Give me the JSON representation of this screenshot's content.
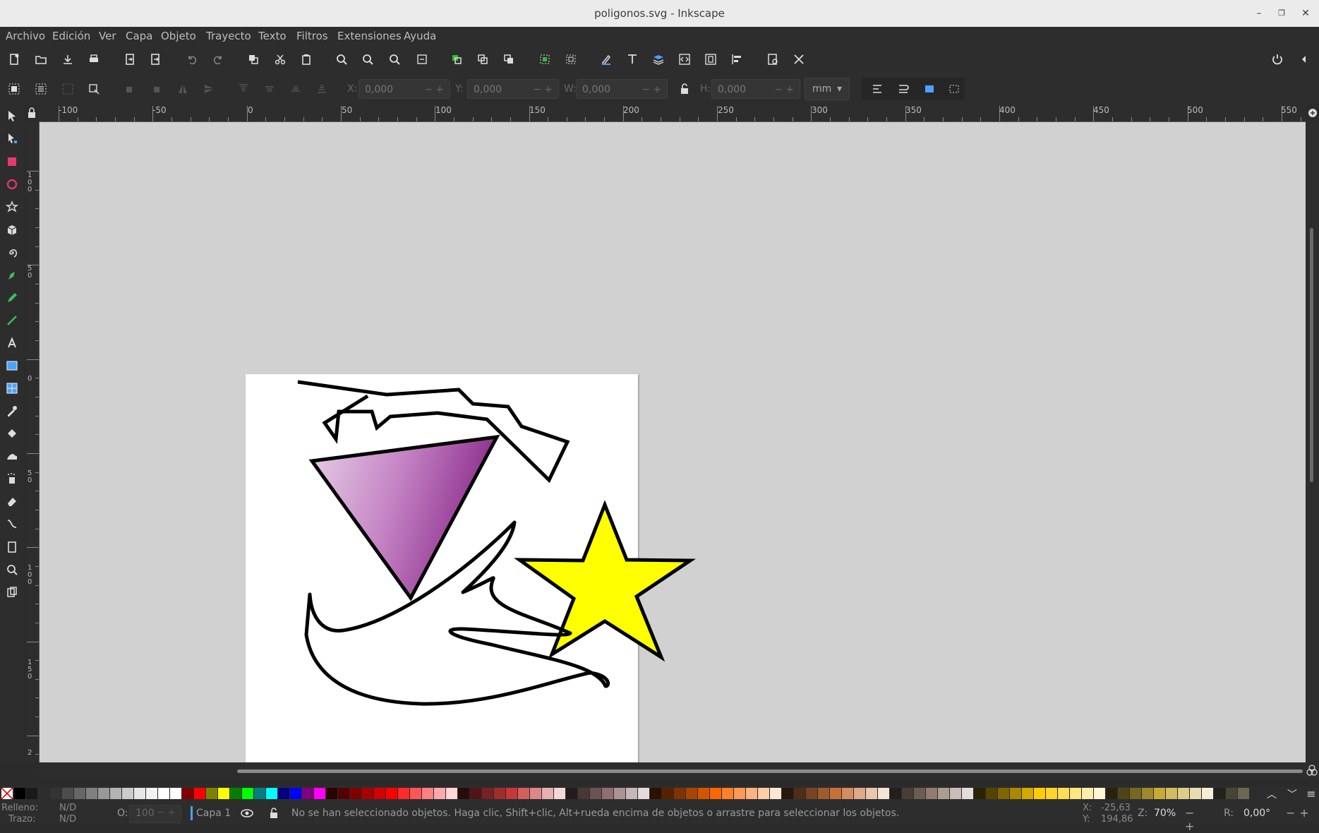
{
  "window": {
    "title": "poligonos.svg - Inkscape"
  },
  "menu": [
    "Archivo",
    "Edición",
    "Ver",
    "Capa",
    "Objeto",
    "Trayecto",
    "Texto",
    "Filtros",
    "Extensiones",
    "Ayuda"
  ],
  "toolbar": {
    "x_label": "X:",
    "x_value": "0,000",
    "y_label": "Y:",
    "y_value": "0,000",
    "w_label": "W:",
    "w_value": "0,000",
    "h_label": "H:",
    "h_value": "0,000",
    "unit": "mm"
  },
  "ruler": {
    "h_labels": [
      "-100",
      "-50",
      "0",
      "50",
      "100",
      "150",
      "200",
      "250",
      "300",
      "350",
      "400",
      "450",
      "500",
      "550"
    ],
    "v_labels": [
      "100",
      "50",
      "0",
      "50",
      "100",
      "150",
      "2"
    ]
  },
  "colors": {
    "triangle_gradient_light": "#e6cfe6",
    "triangle_gradient_dark": "#8a2a8a",
    "star_fill": "#ffff00",
    "stroke": "#000000",
    "canvas": "#d1d1d1"
  },
  "palette": [
    "#000000",
    "#1a1a1a",
    "#333333",
    "#4d4d4d",
    "#666666",
    "#808080",
    "#999999",
    "#b3b3b3",
    "#cccccc",
    "#e6e6e6",
    "#f2f2f2",
    "#ffffff",
    "#ffffff",
    "#800000",
    "#ff0000",
    "#808000",
    "#ffff00",
    "#008000",
    "#00ff00",
    "#008080",
    "#00ffff",
    "#000080",
    "#0000ff",
    "#800080",
    "#ff00ff",
    "#2b0000",
    "#550000",
    "#800000",
    "#aa0000",
    "#d40000",
    "#ff0000",
    "#ff2a2a",
    "#ff5555",
    "#ff8080",
    "#ffaaaa",
    "#ffd5d5",
    "#280b0b",
    "#501616",
    "#782121",
    "#a02c2c",
    "#c83737",
    "#d35f5f",
    "#de8787",
    "#e9afaf",
    "#f4d7d7",
    "#241c1c",
    "#483737",
    "#6c5353",
    "#916f6f",
    "#ac9393",
    "#c8b7b7",
    "#e3dbdb",
    "#2b1100",
    "#552200",
    "#803300",
    "#aa4400",
    "#d45500",
    "#ff6600",
    "#ff7f2a",
    "#ff9955",
    "#ffb380",
    "#ffccaa",
    "#ffe6d5",
    "#28170b",
    "#502d16",
    "#784421",
    "#a05a2c",
    "#c87137",
    "#d38d5f",
    "#deaa87",
    "#e9c6af",
    "#f4e3d7",
    "#241f1c",
    "#483e37",
    "#6c5d53",
    "#917c6f",
    "#ac9d93",
    "#c8beb7",
    "#e3dedb",
    "#2b2200",
    "#554400",
    "#806600",
    "#aa8800",
    "#d4aa00",
    "#ffcc00",
    "#ffd42a",
    "#ffdd55",
    "#ffe680",
    "#ffeeaa",
    "#fff6d5",
    "#28220b",
    "#504416",
    "#786721",
    "#a0892c",
    "#c8ab37",
    "#d3bc5f",
    "#decd87",
    "#e9ddaf",
    "#f4eed7",
    "#24221c",
    "#484537",
    "#6c6753"
  ],
  "status": {
    "fill_label": "Relleno:",
    "fill_value": "N/D",
    "stroke_label": "Trazo:",
    "stroke_value": "N/D",
    "opacity_label": "O:",
    "opacity_value": "100",
    "layer": "Capa 1",
    "message": "No se han seleccionado objetos. Haga clic, Shift+clic, Alt+rueda encima de objetos o arrastre para seleccionar los objetos.",
    "x_label": "X:",
    "x_value": "-25,63",
    "y_label": "Y:",
    "y_value": "194,86",
    "zoom_label": "Z:",
    "zoom_value": "70%",
    "rotation_label": "R:",
    "rotation_value": "0,00°"
  }
}
